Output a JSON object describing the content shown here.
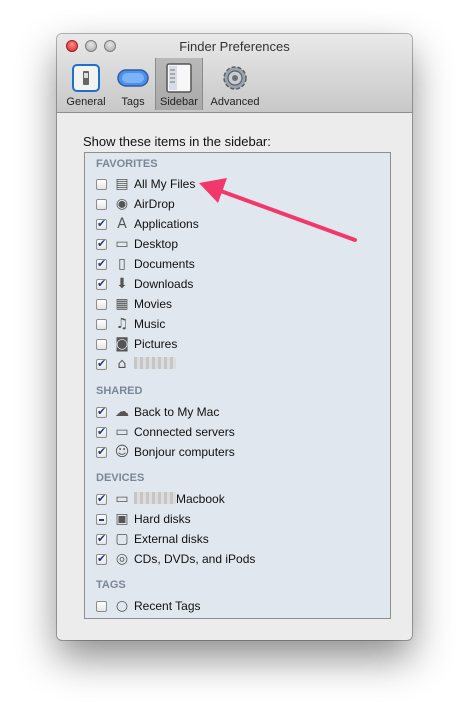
{
  "window": {
    "title": "Finder Preferences"
  },
  "toolbar": {
    "items": [
      {
        "label": "General"
      },
      {
        "label": "Tags"
      },
      {
        "label": "Sidebar",
        "selected": true
      },
      {
        "label": "Advanced"
      }
    ]
  },
  "content": {
    "heading": "Show these items in the sidebar:"
  },
  "sections": {
    "favorites": {
      "title": "FAVORITES",
      "items": [
        {
          "label": "All My Files",
          "checked": false,
          "icon": "all-my-files-icon"
        },
        {
          "label": "AirDrop",
          "checked": false,
          "icon": "airdrop-icon"
        },
        {
          "label": "Applications",
          "checked": true,
          "icon": "applications-icon"
        },
        {
          "label": "Desktop",
          "checked": true,
          "icon": "desktop-icon"
        },
        {
          "label": "Documents",
          "checked": true,
          "icon": "documents-icon"
        },
        {
          "label": "Downloads",
          "checked": true,
          "icon": "downloads-icon"
        },
        {
          "label": "Movies",
          "checked": false,
          "icon": "movies-icon"
        },
        {
          "label": "Music",
          "checked": false,
          "icon": "music-icon"
        },
        {
          "label": "Pictures",
          "checked": false,
          "icon": "pictures-icon"
        },
        {
          "label": "",
          "checked": true,
          "icon": "home-icon",
          "redacted": true
        }
      ]
    },
    "shared": {
      "title": "SHARED",
      "items": [
        {
          "label": "Back to My Mac",
          "checked": true,
          "icon": "cloud-icon"
        },
        {
          "label": "Connected servers",
          "checked": true,
          "icon": "server-icon"
        },
        {
          "label": "Bonjour computers",
          "checked": true,
          "icon": "bonjour-icon"
        }
      ]
    },
    "devices": {
      "title": "DEVICES",
      "items": [
        {
          "label": "Macbook",
          "checked": true,
          "icon": "laptop-icon",
          "redacted_prefix": true
        },
        {
          "label": "Hard disks",
          "checked": "mixed",
          "icon": "hard-disk-icon"
        },
        {
          "label": "External disks",
          "checked": true,
          "icon": "external-disk-icon"
        },
        {
          "label": "CDs, DVDs, and iPods",
          "checked": true,
          "icon": "cd-icon"
        }
      ]
    },
    "tags": {
      "title": "TAGS",
      "items": [
        {
          "label": "Recent Tags",
          "checked": false,
          "icon": "tag-circle-icon"
        }
      ]
    }
  },
  "colors": {
    "annotation_arrow": "#f2386b",
    "list_background": "#e1e7ee",
    "section_header": "#7a8699"
  }
}
